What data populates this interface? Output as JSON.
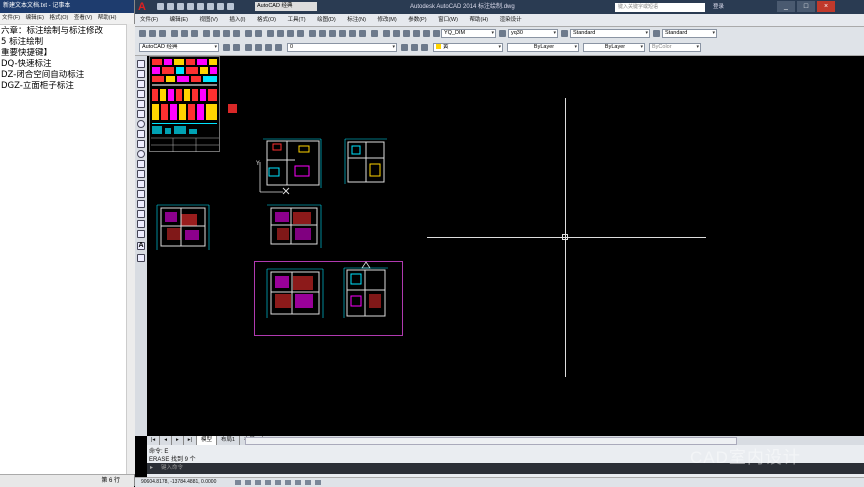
{
  "notepad": {
    "title": "新建文本文档.txt - 记事本",
    "menu": [
      "文件(F)",
      "编辑(E)",
      "格式(O)",
      "查看(V)",
      "帮助(H)"
    ],
    "lines": [
      "六章：标注绘制与标注修改",
      "5 标注绘制",
      "重要快捷键】",
      "DQ-快速标注",
      "DZ-闭合空间自动标注",
      "DGZ-立面柜子标注"
    ],
    "status": "第 6 行"
  },
  "cad": {
    "app_logo": "A",
    "workspace": "AutoCAD 经典",
    "title": "Autodesk AutoCAD 2014    标注绘制.dwg",
    "search_placeholder": "键入关键字或短语",
    "login": "登录",
    "window_buttons": [
      "_",
      "□",
      "×"
    ],
    "menu": [
      "文件(F)",
      "编辑(E)",
      "视图(V)",
      "插入(I)",
      "格式(O)",
      "工具(T)",
      "绘图(D)",
      "标注(N)",
      "修改(M)",
      "参数(P)",
      "窗口(W)",
      "帮助(H)",
      "渲染设计"
    ],
    "toolbar1": {
      "dim_style": "YQ_DIM",
      "text_style": "yq30",
      "table_style": "Standard",
      "multileader_style": "Standard"
    },
    "toolbar2": {
      "workspace": "AutoCAD 经典",
      "layer": "0",
      "color": "黄",
      "linetype": "ByLayer",
      "lineweight": "ByLayer",
      "plotstyle": "ByColor"
    },
    "layout_tabs": [
      "模型",
      "布局1",
      "布局2"
    ],
    "command": {
      "line1": "命令: E",
      "line2": "ERASE 找到 9 个",
      "prompt": "键入命令"
    },
    "coords": "90604.8178, -13784.4881, 0.0000"
  },
  "colors": {
    "canvas": "#000000",
    "selection": "#b03ab0",
    "magenta": "#ff00ff",
    "cyan": "#00e5ff",
    "red": "#ff3030",
    "yellow": "#ffd400"
  },
  "watermark": "CAD室内设计"
}
